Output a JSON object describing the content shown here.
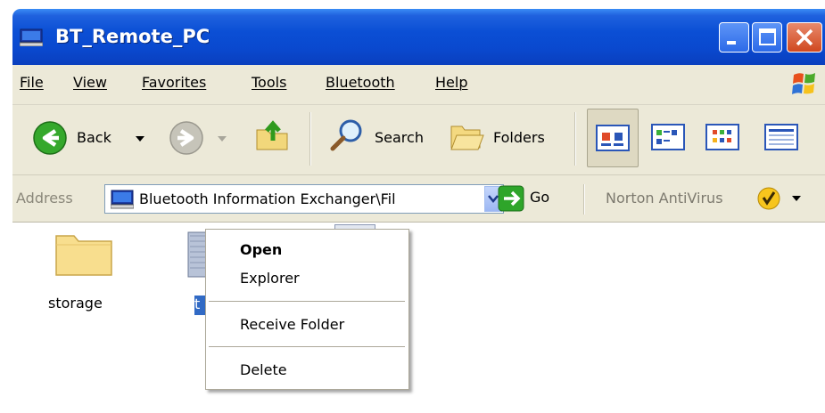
{
  "window": {
    "title": "BT_Remote_PC"
  },
  "menu": [
    "File",
    "View",
    "Favorites",
    "Tools",
    "Bluetooth",
    "Help"
  ],
  "toolbar": {
    "back_label": "Back",
    "search_label": "Search",
    "folders_label": "Folders"
  },
  "address": {
    "label": "Address",
    "value": "Bluetooth Information Exchanger\\Fil",
    "go_label": "Go",
    "norton_label": "Norton AntiVirus"
  },
  "files": [
    {
      "name": "storage",
      "type": "folder"
    },
    {
      "name": "t",
      "type": "file",
      "selected": true
    }
  ],
  "context_menu": {
    "items": [
      "Open",
      "Explorer",
      "Receive Folder",
      "Delete"
    ]
  },
  "colors": {
    "titlebar": "#0a49cf",
    "chrome": "#ece9d8",
    "selection": "#316ac5"
  }
}
